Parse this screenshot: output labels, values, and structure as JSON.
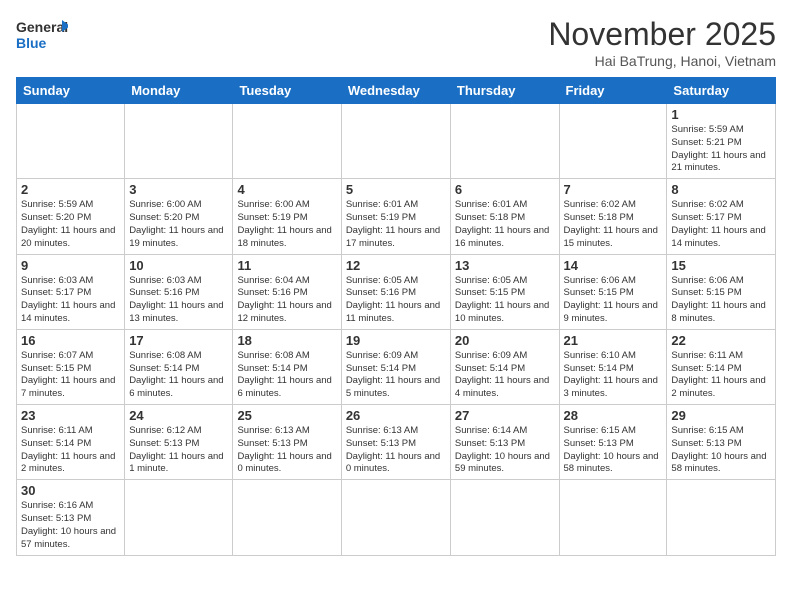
{
  "header": {
    "logo_general": "General",
    "logo_blue": "Blue",
    "month_title": "November 2025",
    "location": "Hai BaTrung, Hanoi, Vietnam"
  },
  "weekdays": [
    "Sunday",
    "Monday",
    "Tuesday",
    "Wednesday",
    "Thursday",
    "Friday",
    "Saturday"
  ],
  "weeks": [
    [
      {
        "day": "",
        "info": ""
      },
      {
        "day": "",
        "info": ""
      },
      {
        "day": "",
        "info": ""
      },
      {
        "day": "",
        "info": ""
      },
      {
        "day": "",
        "info": ""
      },
      {
        "day": "",
        "info": ""
      },
      {
        "day": "1",
        "info": "Sunrise: 5:59 AM\nSunset: 5:21 PM\nDaylight: 11 hours and 21 minutes."
      }
    ],
    [
      {
        "day": "2",
        "info": "Sunrise: 5:59 AM\nSunset: 5:20 PM\nDaylight: 11 hours and 20 minutes."
      },
      {
        "day": "3",
        "info": "Sunrise: 6:00 AM\nSunset: 5:20 PM\nDaylight: 11 hours and 19 minutes."
      },
      {
        "day": "4",
        "info": "Sunrise: 6:00 AM\nSunset: 5:19 PM\nDaylight: 11 hours and 18 minutes."
      },
      {
        "day": "5",
        "info": "Sunrise: 6:01 AM\nSunset: 5:19 PM\nDaylight: 11 hours and 17 minutes."
      },
      {
        "day": "6",
        "info": "Sunrise: 6:01 AM\nSunset: 5:18 PM\nDaylight: 11 hours and 16 minutes."
      },
      {
        "day": "7",
        "info": "Sunrise: 6:02 AM\nSunset: 5:18 PM\nDaylight: 11 hours and 15 minutes."
      },
      {
        "day": "8",
        "info": "Sunrise: 6:02 AM\nSunset: 5:17 PM\nDaylight: 11 hours and 14 minutes."
      }
    ],
    [
      {
        "day": "9",
        "info": "Sunrise: 6:03 AM\nSunset: 5:17 PM\nDaylight: 11 hours and 14 minutes."
      },
      {
        "day": "10",
        "info": "Sunrise: 6:03 AM\nSunset: 5:16 PM\nDaylight: 11 hours and 13 minutes."
      },
      {
        "day": "11",
        "info": "Sunrise: 6:04 AM\nSunset: 5:16 PM\nDaylight: 11 hours and 12 minutes."
      },
      {
        "day": "12",
        "info": "Sunrise: 6:05 AM\nSunset: 5:16 PM\nDaylight: 11 hours and 11 minutes."
      },
      {
        "day": "13",
        "info": "Sunrise: 6:05 AM\nSunset: 5:15 PM\nDaylight: 11 hours and 10 minutes."
      },
      {
        "day": "14",
        "info": "Sunrise: 6:06 AM\nSunset: 5:15 PM\nDaylight: 11 hours and 9 minutes."
      },
      {
        "day": "15",
        "info": "Sunrise: 6:06 AM\nSunset: 5:15 PM\nDaylight: 11 hours and 8 minutes."
      }
    ],
    [
      {
        "day": "16",
        "info": "Sunrise: 6:07 AM\nSunset: 5:15 PM\nDaylight: 11 hours and 7 minutes."
      },
      {
        "day": "17",
        "info": "Sunrise: 6:08 AM\nSunset: 5:14 PM\nDaylight: 11 hours and 6 minutes."
      },
      {
        "day": "18",
        "info": "Sunrise: 6:08 AM\nSunset: 5:14 PM\nDaylight: 11 hours and 6 minutes."
      },
      {
        "day": "19",
        "info": "Sunrise: 6:09 AM\nSunset: 5:14 PM\nDaylight: 11 hours and 5 minutes."
      },
      {
        "day": "20",
        "info": "Sunrise: 6:09 AM\nSunset: 5:14 PM\nDaylight: 11 hours and 4 minutes."
      },
      {
        "day": "21",
        "info": "Sunrise: 6:10 AM\nSunset: 5:14 PM\nDaylight: 11 hours and 3 minutes."
      },
      {
        "day": "22",
        "info": "Sunrise: 6:11 AM\nSunset: 5:14 PM\nDaylight: 11 hours and 2 minutes."
      }
    ],
    [
      {
        "day": "23",
        "info": "Sunrise: 6:11 AM\nSunset: 5:14 PM\nDaylight: 11 hours and 2 minutes."
      },
      {
        "day": "24",
        "info": "Sunrise: 6:12 AM\nSunset: 5:13 PM\nDaylight: 11 hours and 1 minute."
      },
      {
        "day": "25",
        "info": "Sunrise: 6:13 AM\nSunset: 5:13 PM\nDaylight: 11 hours and 0 minutes."
      },
      {
        "day": "26",
        "info": "Sunrise: 6:13 AM\nSunset: 5:13 PM\nDaylight: 11 hours and 0 minutes."
      },
      {
        "day": "27",
        "info": "Sunrise: 6:14 AM\nSunset: 5:13 PM\nDaylight: 10 hours and 59 minutes."
      },
      {
        "day": "28",
        "info": "Sunrise: 6:15 AM\nSunset: 5:13 PM\nDaylight: 10 hours and 58 minutes."
      },
      {
        "day": "29",
        "info": "Sunrise: 6:15 AM\nSunset: 5:13 PM\nDaylight: 10 hours and 58 minutes."
      }
    ],
    [
      {
        "day": "30",
        "info": "Sunrise: 6:16 AM\nSunset: 5:13 PM\nDaylight: 10 hours and 57 minutes."
      },
      {
        "day": "",
        "info": ""
      },
      {
        "day": "",
        "info": ""
      },
      {
        "day": "",
        "info": ""
      },
      {
        "day": "",
        "info": ""
      },
      {
        "day": "",
        "info": ""
      },
      {
        "day": "",
        "info": ""
      }
    ]
  ]
}
